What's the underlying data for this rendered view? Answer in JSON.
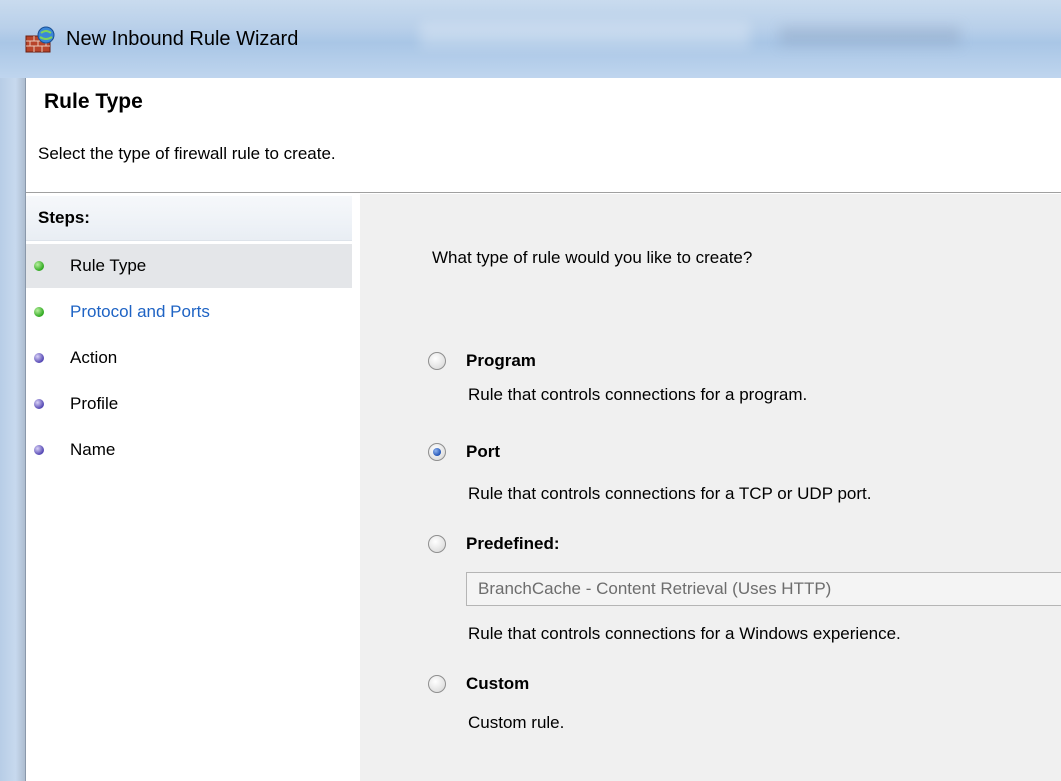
{
  "window": {
    "title": "New Inbound Rule Wizard",
    "icon": "firewall-icon"
  },
  "header": {
    "title": "Rule Type",
    "subtitle": "Select the type of firewall rule to create."
  },
  "steps": {
    "heading": "Steps:",
    "items": [
      {
        "label": "Rule Type",
        "state": "completed",
        "selected": true
      },
      {
        "label": "Protocol and Ports",
        "state": "completed",
        "selected": false
      },
      {
        "label": "Action",
        "state": "pending",
        "selected": false
      },
      {
        "label": "Profile",
        "state": "pending",
        "selected": false
      },
      {
        "label": "Name",
        "state": "pending",
        "selected": false
      }
    ]
  },
  "main": {
    "question": "What type of rule would you like to create?",
    "options": [
      {
        "label": "Program",
        "description": "Rule that controls connections for a program.",
        "checked": false
      },
      {
        "label": "Port",
        "description": "Rule that controls connections for a TCP or UDP port.",
        "checked": true
      },
      {
        "label": "Predefined:",
        "description": "Rule that controls connections for a Windows experience.",
        "checked": false
      },
      {
        "label": "Custom",
        "description": "Custom rule.",
        "checked": false
      }
    ],
    "predefined_value": "BranchCache - Content Retrieval (Uses HTTP)"
  },
  "colors": {
    "completed_dot": "#2ea81e",
    "pending_dot": "#5346b3",
    "link_text": "#1e63c4",
    "content_bg": "#f0f0f0"
  }
}
